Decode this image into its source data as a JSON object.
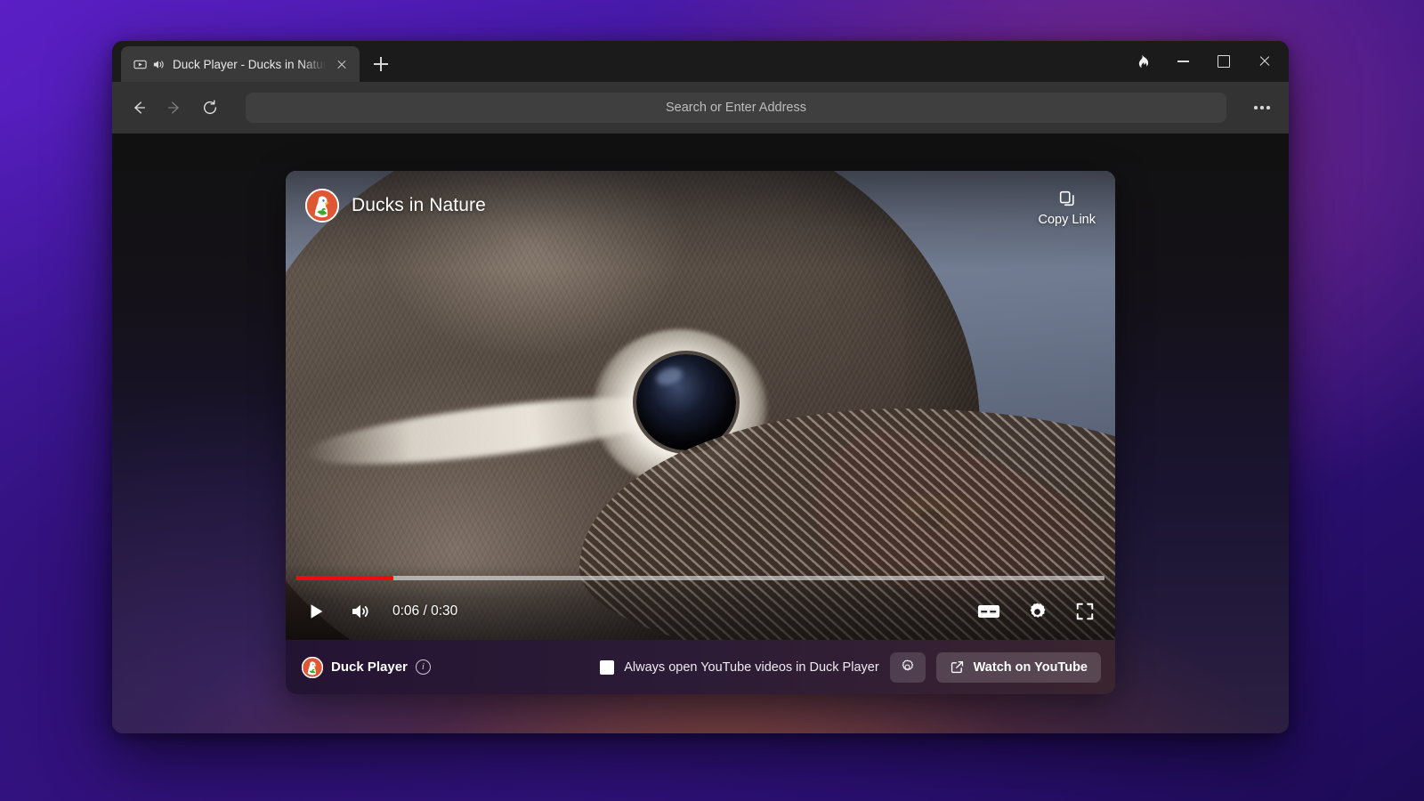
{
  "browser": {
    "tab": {
      "title": "Duck Player - Ducks in Nature",
      "media_icon": "video-play-icon",
      "audio_icon": "speaker-playing-icon",
      "close_icon": "close-icon"
    },
    "new_tab_icon": "plus-icon",
    "window_controls": {
      "fire_icon": "fire-button-icon",
      "minimize_icon": "minimize-icon",
      "maximize_icon": "maximize-icon",
      "close_icon": "close-icon"
    },
    "toolbar": {
      "back_icon": "back-arrow-icon",
      "forward_icon": "forward-arrow-icon",
      "reload_icon": "reload-icon",
      "more_icon": "more-options-icon",
      "address_placeholder": "Search or Enter Address",
      "address_value": ""
    }
  },
  "player": {
    "logo_icon": "duckduckgo-logo-icon",
    "video_title": "Ducks in Nature",
    "copy_link": {
      "label": "Copy Link",
      "icon": "copy-icon"
    },
    "controls": {
      "play_icon": "play-icon",
      "volume_icon": "volume-on-icon",
      "time": "0:06 / 0:30",
      "current_time": "0:06",
      "duration": "0:30",
      "progress_percent": 12,
      "captions_icon": "closed-captions-icon",
      "settings_icon": "gear-icon",
      "fullscreen_icon": "fullscreen-icon",
      "progress_color": "#f00b0b"
    },
    "bottom_bar": {
      "brand_logo_icon": "duckduckgo-logo-icon",
      "brand_name": "Duck Player",
      "info_icon": "info-icon",
      "info_glyph": "i",
      "always_open_label": "Always open YouTube videos in Duck Player",
      "always_open_checked": false,
      "settings_icon": "gear-icon",
      "watch_label": "Watch on YouTube",
      "watch_icon": "external-link-icon"
    }
  },
  "colors": {
    "accent_red": "#f00b0b",
    "ddg_orange": "#de5833",
    "desktop_purple": "#4b1bb0"
  }
}
